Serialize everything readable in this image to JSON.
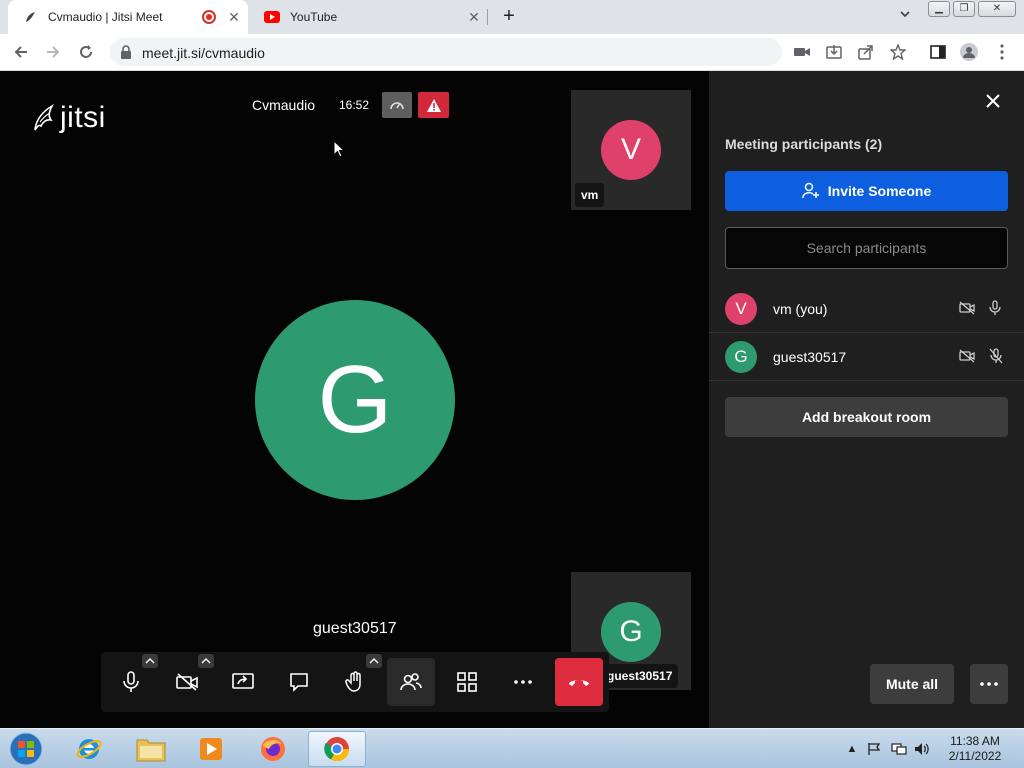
{
  "browser": {
    "tabs": [
      {
        "title": "Cvmaudio | Jitsi Meet",
        "active": true,
        "recording": true
      },
      {
        "title": "YouTube",
        "active": false
      }
    ],
    "url": "meet.jit.si/cvmaudio"
  },
  "meeting": {
    "logo_text": "jitsi",
    "name": "Cvmaudio",
    "time": "16:52",
    "dominant_speaker": {
      "initial": "G",
      "name": "guest30517",
      "color": "#2d9a70"
    },
    "thumbnails": [
      {
        "initial": "V",
        "label": "vm",
        "color": "#e0416a"
      },
      {
        "initial": "G",
        "label": "guest30517",
        "color": "#2d9a70"
      }
    ]
  },
  "panel": {
    "title": "Meeting participants (2)",
    "invite_label": "Invite Someone",
    "search_placeholder": "Search participants",
    "participants": [
      {
        "initial": "V",
        "name": "vm (you)",
        "color": "#e0416a",
        "video_muted": true,
        "audio_muted": false
      },
      {
        "initial": "G",
        "name": "guest30517",
        "color": "#2d9a70",
        "video_muted": true,
        "audio_muted": true
      }
    ],
    "breakout_label": "Add breakout room",
    "mute_all_label": "Mute all"
  },
  "taskbar": {
    "time": "11:38 AM",
    "date": "2/11/2022"
  }
}
